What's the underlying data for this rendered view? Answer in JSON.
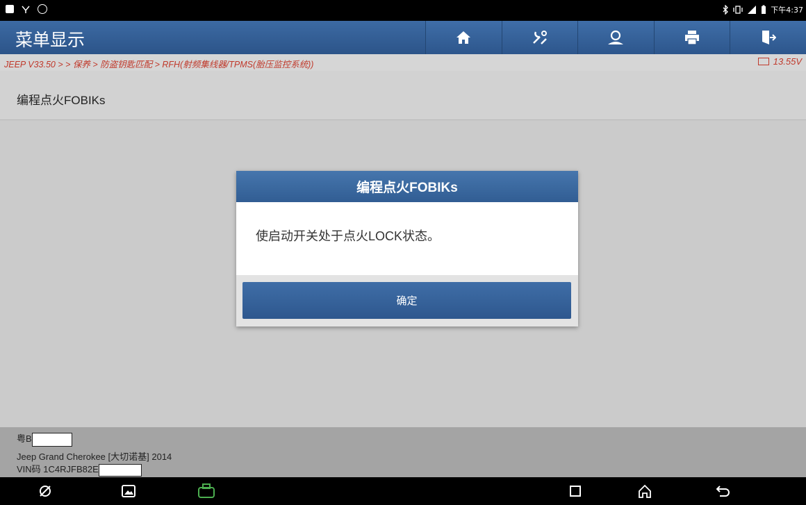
{
  "status_bar": {
    "time": "下午4:37",
    "left_icons": [
      "image-icon",
      "usb-icon",
      "settings-icon"
    ],
    "right_icons": [
      "bluetooth-icon",
      "vibrate-icon",
      "signal-icon",
      "battery-icon"
    ]
  },
  "header": {
    "title": "菜单显示",
    "toolbar": [
      "home-icon",
      "diagnose-icon",
      "user-icon",
      "print-icon",
      "exit-icon"
    ]
  },
  "breadcrumb": {
    "path": "JEEP V33.50 > > 保养 > 防盗钥匙匹配 > RFH(射频集线器/TPMS(胎压监控系统))",
    "voltage": "13.55V"
  },
  "page": {
    "title": "编程点火FOBIKs"
  },
  "dialog": {
    "title": "编程点火FOBIKs",
    "message": "使启动开关处于点火LOCK状态。",
    "ok_label": "确定"
  },
  "footer": {
    "plate": "粤B",
    "vehicle": "Jeep Grand Cherokee [大切诺基] 2014",
    "vin": "VIN码 1C4RJFB82E"
  },
  "navbar": {
    "left": [
      "browser-icon",
      "gallery-icon",
      "vci-icon"
    ],
    "right": [
      "recent-apps-icon",
      "home-icon",
      "back-icon"
    ]
  },
  "colors": {
    "header_blue": "#2c5489",
    "breadcrumb_red": "#c0392b",
    "vci_green": "#4caf50"
  }
}
